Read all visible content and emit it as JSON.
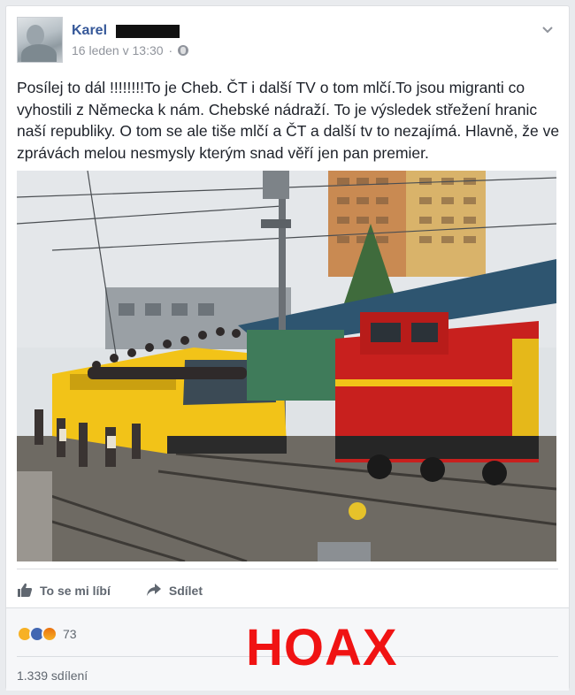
{
  "post": {
    "author_name": "Karel",
    "timestamp": "16 leden v 13:30",
    "meta_separator": "·",
    "text": "Posílej to dál !!!!!!!!To je Cheb. ČT i další TV o tom mlčí.To jsou migranti co vyhostili z Německa k nám. Chebské nádraží. To je výsledek střežení hranic naší republiky. O tom se ale tiše mlčí a ČT a další tv to nezajímá. Hlavně, že ve zprávách melou nesmysly kterým snad věří jen pan premier."
  },
  "actions": {
    "like_label": "To se mi líbí",
    "share_label": "Sdílet"
  },
  "stats": {
    "reactions_count": "73",
    "reaction_icons": [
      "haha-icon",
      "like-icon",
      "angry-icon"
    ],
    "shares_label": "1.339 sdílení"
  },
  "overlay": {
    "stamp_text": "HOAX",
    "stamp_color": "#f01313"
  },
  "colors": {
    "link_blue": "#365899",
    "secondary_text": "#90949c",
    "action_gray": "#606770"
  },
  "icons": {
    "menu": "chevron-down-icon",
    "audience": "globe-icon",
    "like": "thumbs-up-icon",
    "share": "share-arrow-icon"
  }
}
